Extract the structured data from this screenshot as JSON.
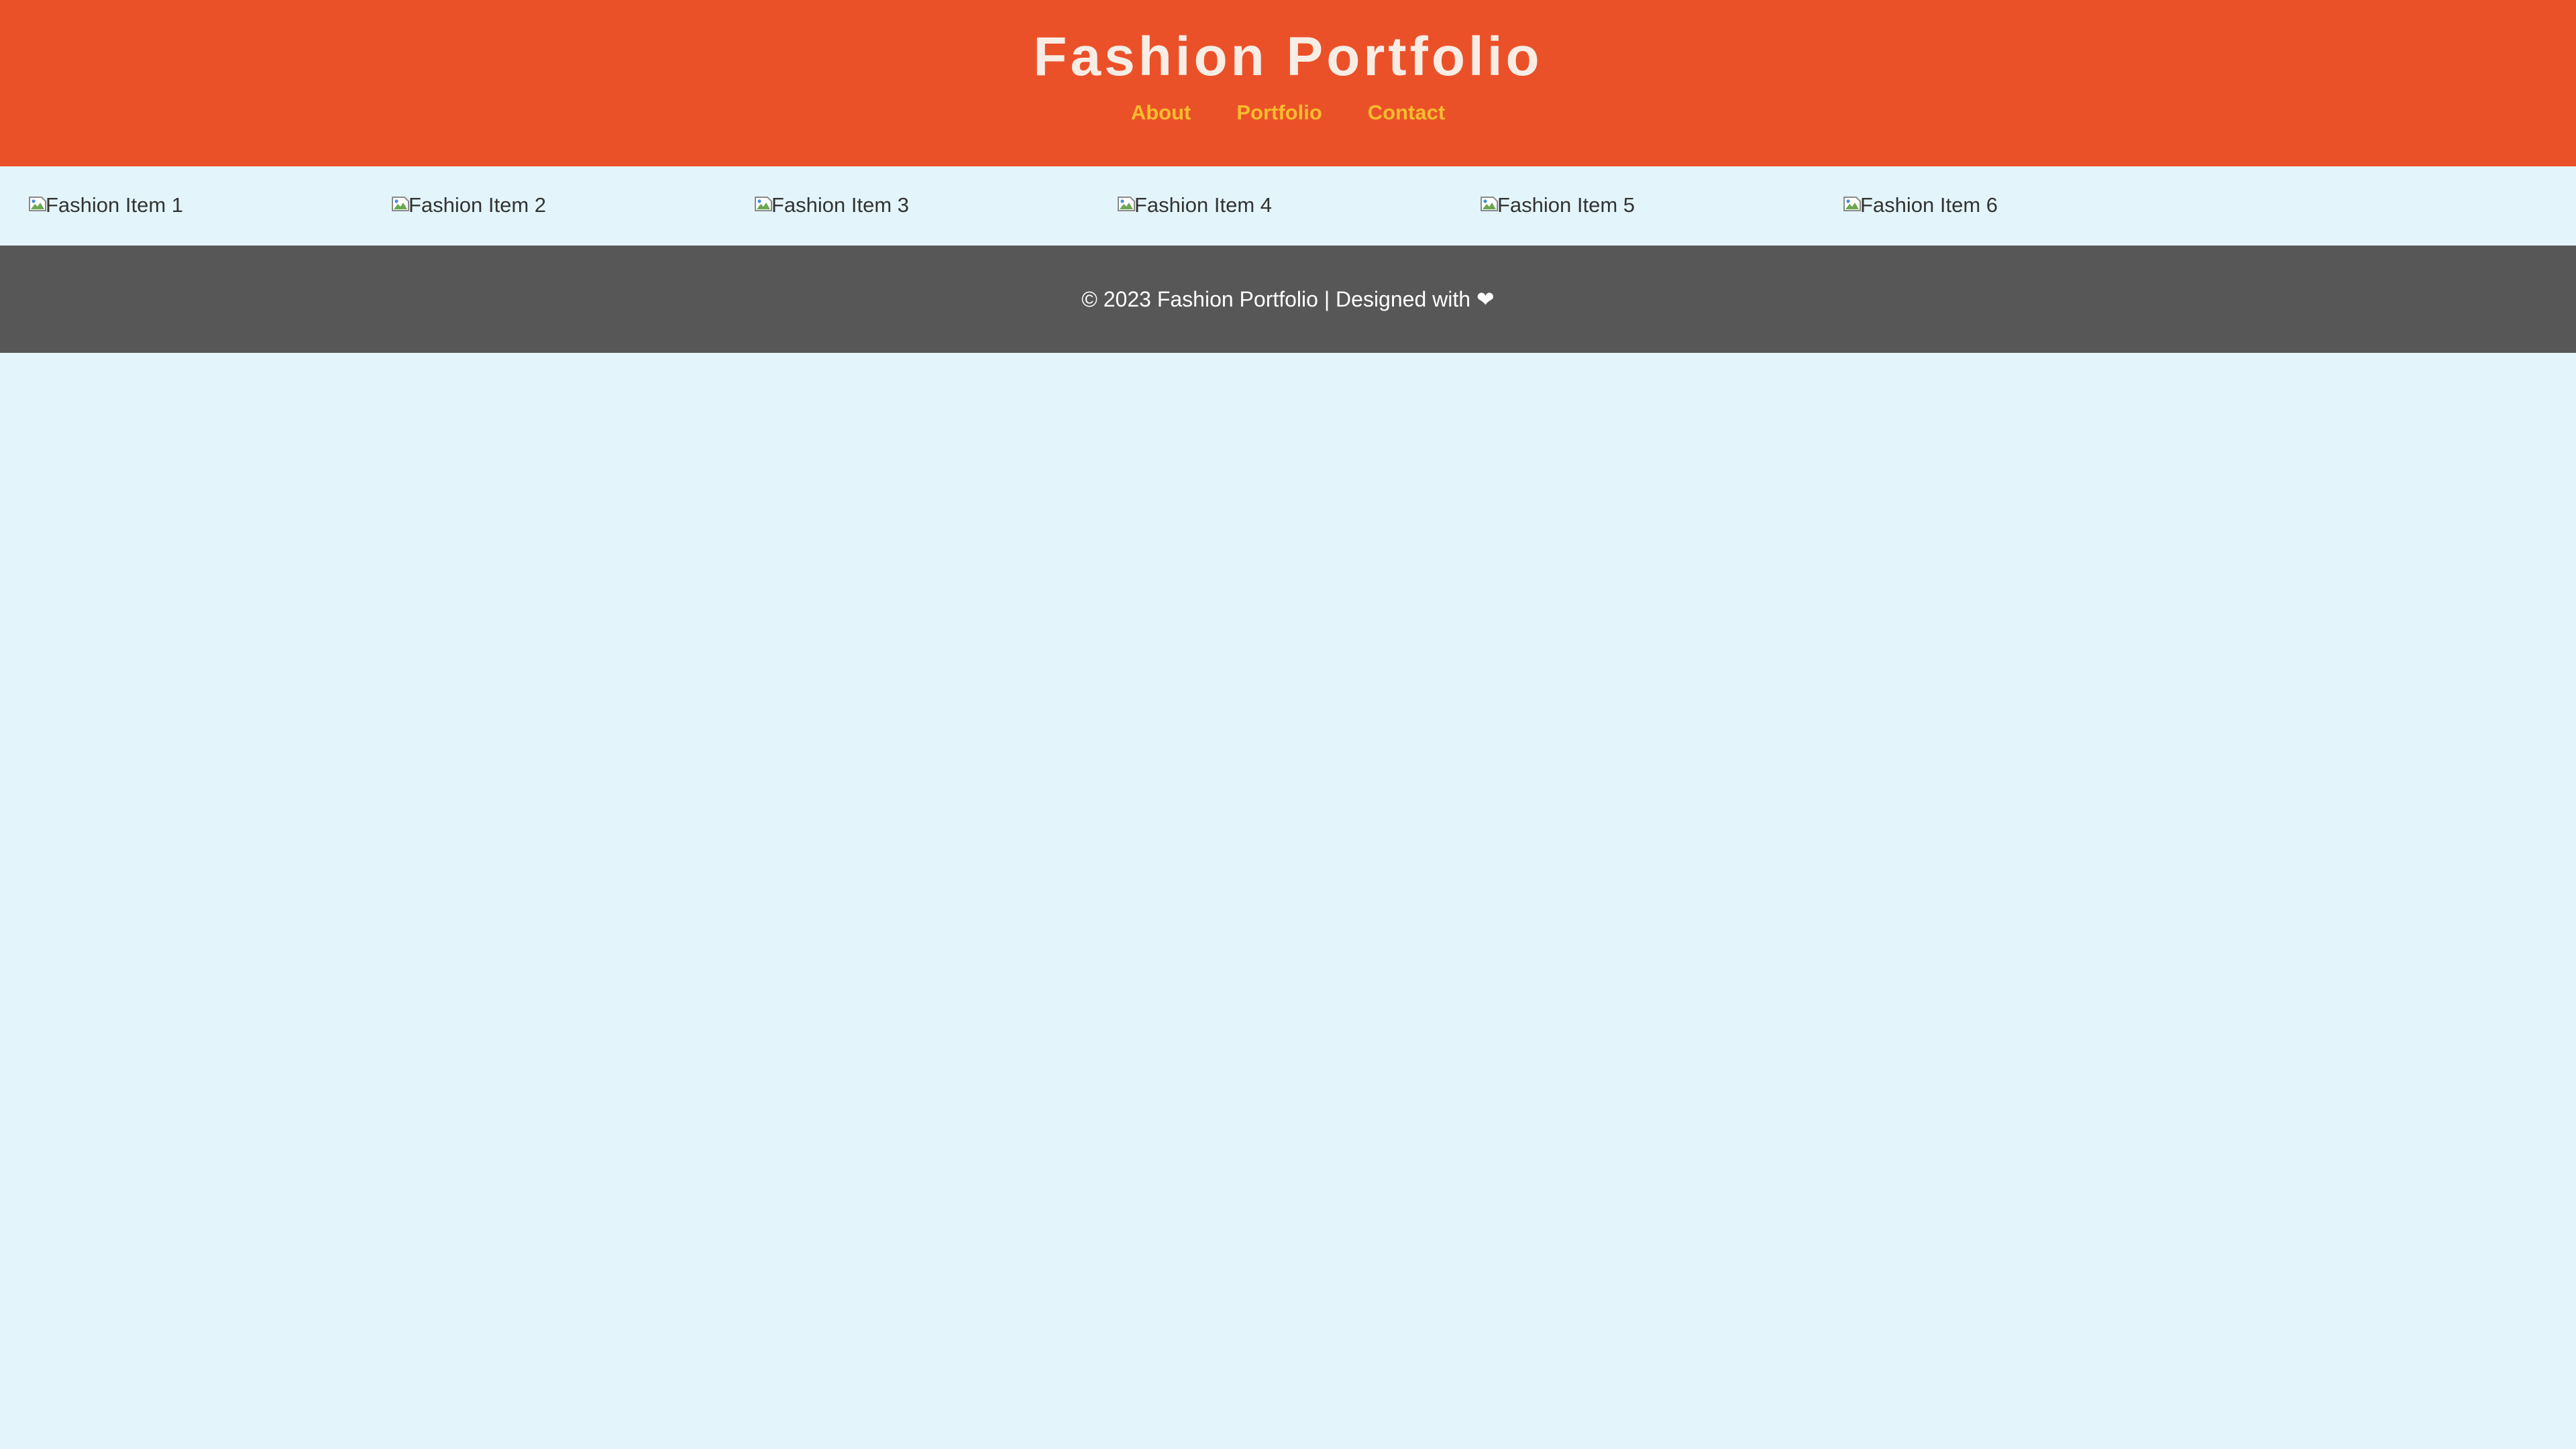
{
  "header": {
    "title": "Fashion Portfolio",
    "nav": [
      {
        "label": "About"
      },
      {
        "label": "Portfolio"
      },
      {
        "label": "Contact"
      }
    ]
  },
  "gallery": {
    "items": [
      {
        "alt": "Fashion Item 1"
      },
      {
        "alt": "Fashion Item 2"
      },
      {
        "alt": "Fashion Item 3"
      },
      {
        "alt": "Fashion Item 4"
      },
      {
        "alt": "Fashion Item 5"
      },
      {
        "alt": "Fashion Item 6"
      }
    ],
    "icon": "broken-image-icon"
  },
  "footer": {
    "text": "© 2023 Fashion Portfolio | Designed with ❤"
  },
  "colors": {
    "header_bg": "#eb5129",
    "nav_link": "#f7bd2d",
    "page_bg": "#e3f5fa",
    "footer_bg": "#575757"
  }
}
